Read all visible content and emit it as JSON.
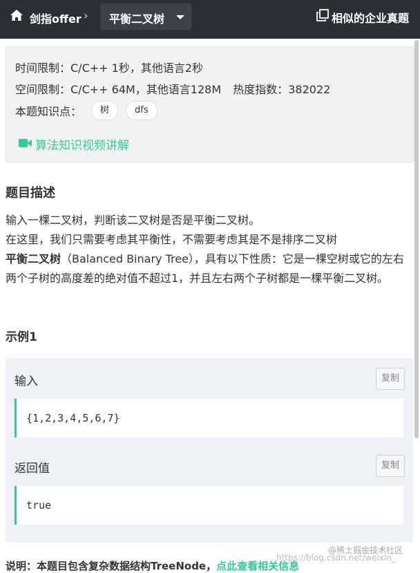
{
  "header": {
    "breadcrumb": "剑指offer",
    "breadcrumb_sep": "›",
    "problem_title": "平衡二叉树",
    "similar_label": "相似的企业真题",
    "colors": {
      "bar": "#2b2f36",
      "accent": "#32ca99"
    },
    "icons": [
      "home-icon",
      "chevron-right-icon",
      "chevron-down-icon",
      "copy-window-icon"
    ]
  },
  "info": {
    "time_limit": "时间限制：C/C++ 1秒，其他语言2秒",
    "space_limit": "空间限制：C/C++ 64M，其他语言128M",
    "heat_label": "热度指数：382022",
    "knowledge_label": "本题知识点：",
    "tags": [
      "树",
      "dfs"
    ],
    "video_link": "算法知识视频讲解"
  },
  "description": {
    "title": "题目描述",
    "line1": "输入一棵二叉树，判断该二叉树是否是平衡二叉树。",
    "line2": "在这里，我们只需要考虑其平衡性，不需要考虑其是不是排序二叉树",
    "bold_term": "平衡二叉树",
    "line3_rest": "（Balanced Binary Tree），具有以下性质：它是一棵空树或它的左右两个子树的高度差的绝对值不超过1，并且左右两个子树都是一棵平衡二叉树。"
  },
  "example": {
    "title": "示例1",
    "input_label": "输入",
    "input_value": "{1,2,3,4,5,6,7}",
    "output_label": "返回值",
    "output_value": "true",
    "copy_label": "复制"
  },
  "bottom": {
    "text_prefix": "说明：本题目包含复杂数据结构TreeNode，",
    "text_link": "点此查看相关信息"
  },
  "watermark": {
    "line1": "@稀土掘金技术社区",
    "line2": "https://blog.csdn.net/weixin_"
  }
}
